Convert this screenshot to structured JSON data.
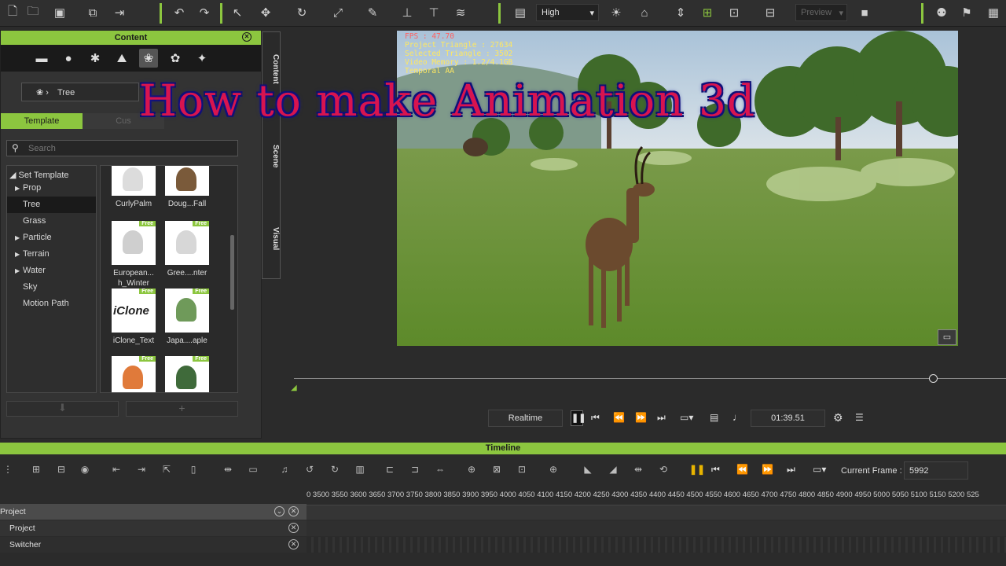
{
  "toolbar": {
    "quality": "High",
    "preview": "Preview"
  },
  "content": {
    "title": "Content",
    "breadcrumb": "Tree",
    "tab_template": "Template",
    "tab_custom": "Cus",
    "search_placeholder": "Search",
    "tree_root": "Set Template",
    "tree": [
      {
        "label": "Prop",
        "arrow": "▶"
      },
      {
        "label": "Tree",
        "arrow": ""
      },
      {
        "label": "Grass",
        "arrow": ""
      },
      {
        "label": "Particle",
        "arrow": "▶"
      },
      {
        "label": "Terrain",
        "arrow": "▶"
      },
      {
        "label": "Water",
        "arrow": "▶"
      },
      {
        "label": "Sky",
        "arrow": ""
      },
      {
        "label": "Motion Path",
        "arrow": ""
      }
    ],
    "thumbs": [
      {
        "label": "CurlyPalm",
        "free": ""
      },
      {
        "label": "Doug...Fall",
        "free": ""
      },
      {
        "label": "European...\nh_Winter",
        "free": "Free"
      },
      {
        "label": "Gree....nter",
        "free": "Free"
      },
      {
        "label": "iClone_Text",
        "free": "Free",
        "logo": "iClone"
      },
      {
        "label": "Japa....aple",
        "free": "Free"
      },
      {
        "label": "",
        "free": "Free"
      },
      {
        "label": "",
        "free": "Free"
      }
    ]
  },
  "side_tabs": {
    "content": "Content",
    "scene": "Scene",
    "visual": "Visual"
  },
  "viewport": {
    "hud": [
      "FPS : 47.70",
      "Project Triangle : 27634",
      "Selected Triangle : 3502",
      "Video Memory : 1.2/4.1GB",
      "Temporal AA"
    ]
  },
  "overlay": {
    "title": "How to make Animation 3d"
  },
  "playback": {
    "mode": "Realtime",
    "time": "01:39.51"
  },
  "timeline": {
    "title": "Timeline",
    "current_frame_label": "Current Frame :",
    "current_frame": "5992",
    "ruler": "0 3500 3550 3600 3650 3700 3750 3800 3850 3900 3950 4000 4050 4100 4150 4200 4250 4300 4350 4400 4450 4500 4550 4600 4650 4700 4750 4800 4850 4900 4950 5000 5050 5100 5150 5200 525",
    "tracks": [
      "Project",
      "Project",
      "Switcher"
    ]
  }
}
